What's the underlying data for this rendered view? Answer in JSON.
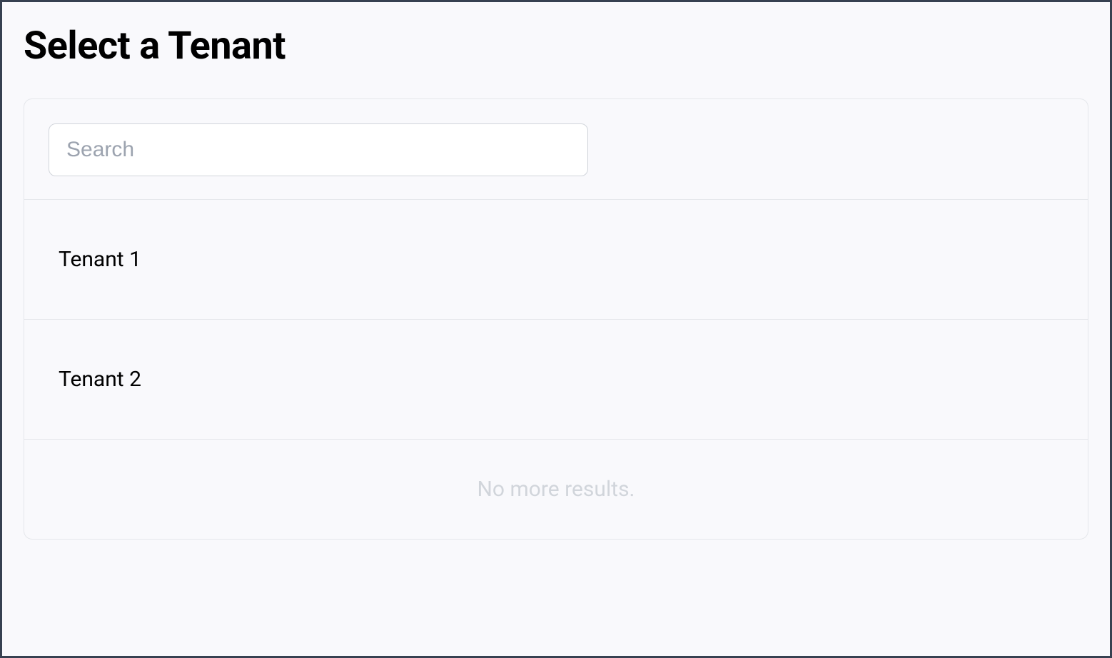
{
  "page": {
    "title": "Select a Tenant"
  },
  "search": {
    "placeholder": "Search",
    "value": ""
  },
  "tenants": [
    {
      "label": "Tenant 1"
    },
    {
      "label": "Tenant 2"
    }
  ],
  "footer": {
    "no_more_results": "No more results."
  }
}
